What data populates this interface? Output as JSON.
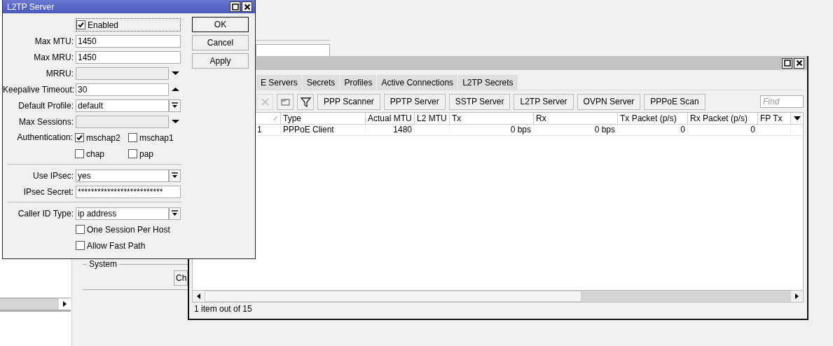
{
  "background_window": {
    "group_label": "System",
    "button": "Ch"
  },
  "dialog": {
    "title": "L2TP Server",
    "rows": [
      {
        "kind": "check",
        "label": "Enabled",
        "checked": true,
        "focused": true
      },
      {
        "kind": "field",
        "label": "Max MTU:",
        "value": "1450",
        "disabled": false
      },
      {
        "kind": "field",
        "label": "Max MRU:",
        "value": "1450",
        "disabled": false
      },
      {
        "kind": "collapsible",
        "label": "MRRU:",
        "disabled": true
      },
      {
        "kind": "expandable",
        "label": "Keepalive Timeout:",
        "value": "30",
        "disabled": false
      },
      {
        "kind": "select",
        "label": "Default Profile:",
        "value": "default",
        "disabled": false
      },
      {
        "kind": "collapsible",
        "label": "Max Sessions:",
        "disabled": true
      },
      {
        "kind": "checks",
        "label": "Authentication:",
        "options": [
          {
            "label": "mschap2",
            "checked": true
          },
          {
            "label": "mschap1",
            "checked": false
          },
          {
            "label": "chap",
            "checked": false
          },
          {
            "label": "pap",
            "checked": false
          }
        ]
      },
      {
        "kind": "separator"
      },
      {
        "kind": "select",
        "label": "Use IPsec:",
        "value": "yes",
        "disabled": false
      },
      {
        "kind": "field",
        "label": "IPsec Secret:",
        "value": "**************************",
        "disabled": false
      },
      {
        "kind": "separator"
      },
      {
        "kind": "select",
        "label": "Caller ID Type:",
        "value": "ip address",
        "disabled": false
      },
      {
        "kind": "check",
        "label": "One Session Per Host",
        "checked": false,
        "focused": false
      },
      {
        "kind": "check",
        "label": "Allow Fast Path",
        "checked": false,
        "focused": false
      }
    ],
    "buttons": [
      {
        "label": "OK",
        "default": true
      },
      {
        "label": "Cancel",
        "default": false
      },
      {
        "label": "Apply",
        "default": false
      }
    ]
  },
  "ppp_window": {
    "tabs": [
      {
        "label": "E Servers",
        "selected": false
      },
      {
        "label": "Secrets",
        "selected": false
      },
      {
        "label": "Profiles",
        "selected": false
      },
      {
        "label": "Active Connections",
        "selected": false
      },
      {
        "label": "L2TP Secrets",
        "selected": false
      }
    ],
    "toolbar": {
      "icons": [
        {
          "kind": "remove",
          "disabled": true
        },
        {
          "kind": "comment",
          "disabled": false
        },
        {
          "kind": "filter",
          "disabled": false
        }
      ],
      "buttons": [
        "PPP Scanner",
        "PPTP Server",
        "SSTP Server",
        "L2TP Server",
        "OVPN Server",
        "PPPoE Scan"
      ],
      "find_placeholder": "Find"
    },
    "table": {
      "columns": [
        {
          "kind": "text",
          "sorted": true
        },
        {
          "label": "Type",
          "kind": "text",
          "sorted": false
        },
        {
          "label": "Actual MTU",
          "kind": "number",
          "sorted": false
        },
        {
          "label": "L2 MTU",
          "kind": "number",
          "sorted": false
        },
        {
          "label": "Tx",
          "kind": "number",
          "sorted": false
        },
        {
          "label": "Rx",
          "kind": "number",
          "sorted": false
        },
        {
          "label": "Tx Packet (p/s)",
          "kind": "number",
          "sorted": false
        },
        {
          "label": "Rx Packet (p/s)",
          "kind": "number",
          "sorted": false
        },
        {
          "label": "FP Tx",
          "kind": "number",
          "sorted": false
        }
      ],
      "rows": [
        {
          "cells": [
            "1",
            "PPPoE Client",
            "1480",
            null,
            "0 bps",
            "0 bps",
            "0",
            "0",
            null
          ]
        }
      ]
    },
    "status_bar": "1 item out of 15"
  }
}
